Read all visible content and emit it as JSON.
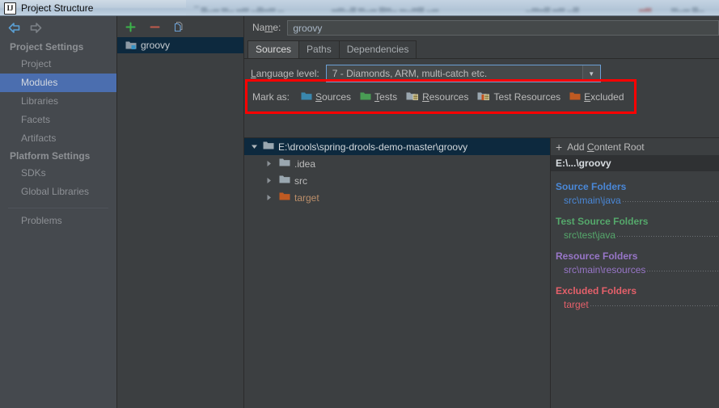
{
  "window": {
    "title": "Project Structure",
    "app_icon": "intellij-idea-icon",
    "blurred_background_text": "blurred desktop window content"
  },
  "sidebar": {
    "back_icon": "back-arrow-icon",
    "forward_icon": "forward-arrow-icon",
    "groups": [
      {
        "title": "Project Settings",
        "items": [
          {
            "label": "Project",
            "selected": false
          },
          {
            "label": "Modules",
            "selected": true
          },
          {
            "label": "Libraries",
            "selected": false
          },
          {
            "label": "Facets",
            "selected": false
          },
          {
            "label": "Artifacts",
            "selected": false
          }
        ]
      },
      {
        "title": "Platform Settings",
        "items": [
          {
            "label": "SDKs",
            "selected": false
          },
          {
            "label": "Global Libraries",
            "selected": false
          }
        ]
      }
    ],
    "problems": "Problems"
  },
  "modules_panel": {
    "toolbar": {
      "add_icon": "plus-icon",
      "remove_icon": "minus-icon",
      "copy_icon": "copy-icon"
    },
    "items": [
      {
        "label": "groovy",
        "icon": "module-folder-icon",
        "selected": true
      }
    ]
  },
  "editor": {
    "name_label": "Name:",
    "name_label_underline": "m",
    "name_value": "groovy",
    "tabs": [
      {
        "label": "Sources",
        "active": true
      },
      {
        "label": "Paths",
        "active": false
      },
      {
        "label": "Dependencies",
        "active": false
      }
    ],
    "language_level": {
      "label": "Language level:",
      "label_underline": "L",
      "value": "7 - Diamonds, ARM, multi-catch etc.",
      "dropdown_icon": "chevron-down-icon",
      "highlight_color": "#ff0000"
    },
    "mark_as": {
      "label": "Mark as:",
      "options": [
        {
          "label": "Sources",
          "underline": "S",
          "color": "#3a87ad",
          "icon": "folder-sources-icon"
        },
        {
          "label": "Tests",
          "underline": "T",
          "color": "#499c54",
          "icon": "folder-tests-icon"
        },
        {
          "label": "Resources",
          "underline": "R",
          "color": "#9aa7b0",
          "icon": "folder-resources-icon"
        },
        {
          "label": "Test Resources",
          "underline": "",
          "color": "#499c54",
          "icon": "folder-test-resources-icon"
        },
        {
          "label": "Excluded",
          "underline": "E",
          "color": "#bf5a22",
          "icon": "folder-excluded-icon"
        }
      ]
    },
    "tree": [
      {
        "label": "E:\\drools\\spring-drools-demo-master\\groovy",
        "depth": 0,
        "expanded": true,
        "selected": true,
        "color": "#9aa7b0"
      },
      {
        "label": ".idea",
        "depth": 1,
        "expanded": false,
        "selected": false,
        "color": "#9aa7b0"
      },
      {
        "label": "src",
        "depth": 1,
        "expanded": false,
        "selected": false,
        "color": "#9aa7b0"
      },
      {
        "label": "target",
        "depth": 1,
        "expanded": false,
        "selected": false,
        "color": "#bf5a22"
      }
    ],
    "content_root": {
      "add_button": "Add Content Root",
      "add_button_underline": "C",
      "add_icon": "plus-icon",
      "root_label": "E:\\...\\groovy",
      "groups": [
        {
          "title": "Source Folders",
          "color": "#4a88d8",
          "items": [
            "src\\main\\java"
          ]
        },
        {
          "title": "Test Source Folders",
          "color": "#55a86b",
          "items": [
            "src\\test\\java"
          ]
        },
        {
          "title": "Resource Folders",
          "color": "#9876c8",
          "items": [
            "src\\main\\resources"
          ]
        },
        {
          "title": "Excluded Folders",
          "color": "#e4606a",
          "items": [
            "target"
          ]
        }
      ]
    }
  }
}
